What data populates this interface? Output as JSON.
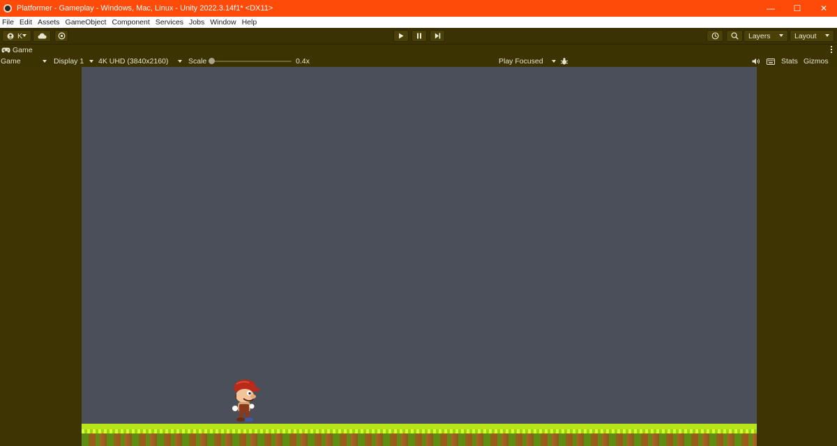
{
  "window": {
    "title": "Platformer - Gameplay - Windows, Mac, Linux - Unity 2022.3.14f1* <DX11>",
    "controls": {
      "minimize": "—",
      "maximize": "☐",
      "close": "✕"
    }
  },
  "menu": [
    "File",
    "Edit",
    "Assets",
    "GameObject",
    "Component",
    "Services",
    "Jobs",
    "Window",
    "Help"
  ],
  "toolbar": {
    "account_label": "K",
    "layers_label": "Layers",
    "layout_label": "Layout"
  },
  "game_tab": {
    "label": "Game"
  },
  "game_bar": {
    "view_mode": "Game",
    "display": "Display 1",
    "resolution": "4K UHD (3840x2160)",
    "scale_label": "Scale",
    "scale_value": "0.4x",
    "play_mode": "Play Focused",
    "stats_label": "Stats",
    "gizmos_label": "Gizmos"
  },
  "colors": {
    "title_bar": "#ff4b0a",
    "editor_bg": "#3b3302",
    "scene_bg": "#4b4f5a",
    "ground_grass": "#b8e51a"
  }
}
